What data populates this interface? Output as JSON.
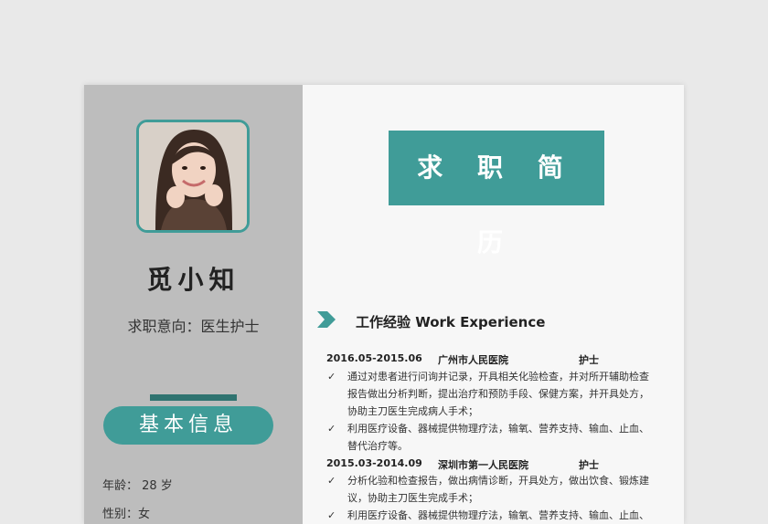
{
  "profile": {
    "name": "觅小知",
    "job_intent": "求职意向：医生护士"
  },
  "basic_info": {
    "heading": "基本信息",
    "age": "年龄： 28 岁",
    "gender": "性别：女"
  },
  "resume_title": "求 职 简 历",
  "work_section": {
    "title": "工作经验  Work Experience",
    "jobs": [
      {
        "period": "2016.05-2015.06",
        "org": "广州市人民医院",
        "role": "护士",
        "items": [
          "通过对患者进行问询并记录，开具相关化验检查，并对所开辅助检查报告做出分析判断，提出治疗和预防手段、保健方案，并开具处方，协助主刀医生完成病人手术；",
          "利用医疗设备、器械提供物理疗法，输氧、营养支持、输血、止血、替代治疗等。"
        ]
      },
      {
        "period": "2015.03-2014.09",
        "org": "深圳市第一人民医院",
        "role": "护士",
        "items": [
          "分析化验和检查报告，做出病情诊断，开具处方，做出饮食、锻炼建议，协助主刀医生完成手术；",
          "利用医疗设备、器械提供物理疗法，输氧、营养支持、输血、止血、"
        ]
      }
    ]
  },
  "colors": {
    "accent": "#409c98",
    "accent_dark": "#2f7370",
    "sidebar": "#bdbdbd",
    "paper": "#f7f7f7"
  }
}
